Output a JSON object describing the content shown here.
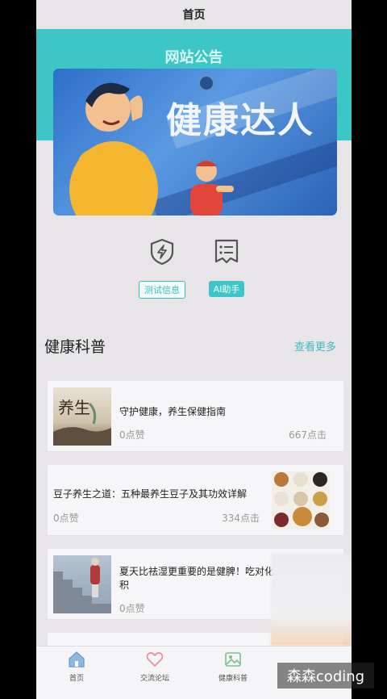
{
  "navbar": {
    "title": "首页"
  },
  "banner": {
    "title": "网站公告",
    "hero_text": "健康达人"
  },
  "features": [
    {
      "label": "测试信息",
      "icon": "shield-lightning-icon"
    },
    {
      "label": "AI助手",
      "icon": "list-document-icon"
    }
  ],
  "section": {
    "title": "健康科普",
    "more": "查看更多"
  },
  "articles": [
    {
      "title": "守护健康，养生保健指南",
      "likes": "0点赞",
      "clicks": "667点击",
      "thumb": "养生",
      "thumb_alt": "yangsheng-painting"
    },
    {
      "title": "豆子养生之道：五种最养生豆子及其功效详解",
      "likes": "0点赞",
      "clicks": "334点击",
      "thumb_alt": "beans-bowls"
    },
    {
      "title": "夏天比祛湿更重要的是健脾！吃对化积",
      "likes": "0点赞",
      "clicks": "",
      "thumb_alt": "stairs-elder"
    }
  ],
  "tabs": [
    {
      "label": "首页",
      "icon": "home-icon"
    },
    {
      "label": "交流论坛",
      "icon": "heart-icon"
    },
    {
      "label": "健康科普",
      "icon": "image-icon"
    }
  ],
  "watermark": "森森coding",
  "colors": {
    "accent": "#3dc6c6",
    "background": "#e7e5e8"
  }
}
